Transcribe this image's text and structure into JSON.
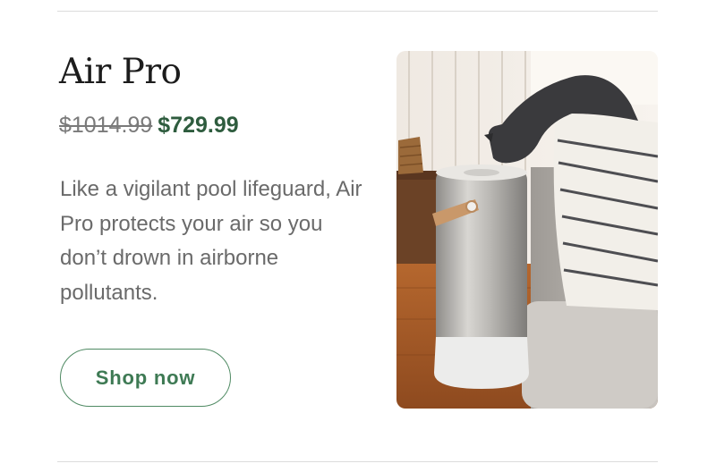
{
  "product": {
    "name": "Air Pro",
    "original_price": "$1014.99",
    "sale_price": "$729.99",
    "description": "Like a vigilant pool lifeguard, Air Pro protects your air so you don’t drown in airborne pollutants.",
    "cta_label": "Shop now"
  },
  "colors": {
    "sale_price": "#2e5c3e",
    "button_border": "#4f8a63",
    "button_text": "#3e7a54"
  }
}
